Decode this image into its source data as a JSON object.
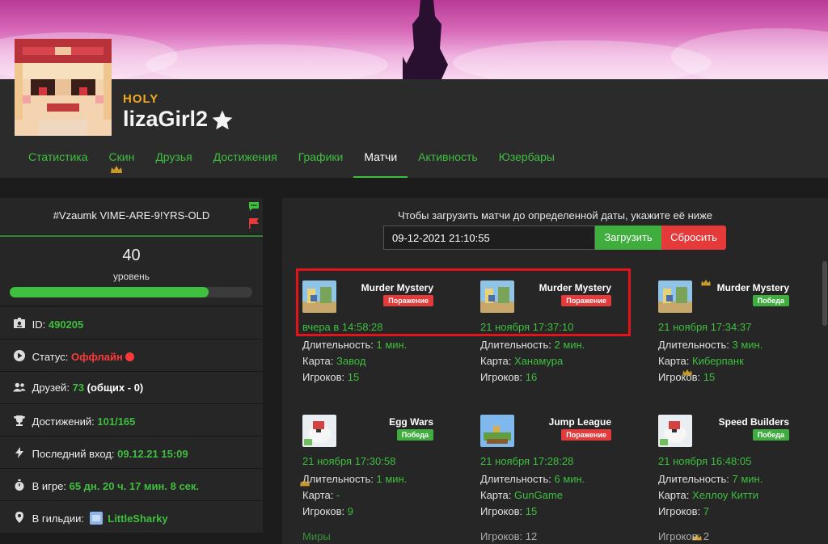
{
  "profile": {
    "rank": "HOLY",
    "nickname": "lizaGirl2"
  },
  "tabs": [
    {
      "label": "Статистика"
    },
    {
      "label": "Скин"
    },
    {
      "label": "Друзья"
    },
    {
      "label": "Достижения"
    },
    {
      "label": "Графики"
    },
    {
      "label": "Матчи"
    },
    {
      "label": "Активность"
    },
    {
      "label": "Юзербары"
    }
  ],
  "active_tab": "Матчи",
  "left": {
    "tag": "#Vzaumk VIME-ARE-9!YRS-OLD",
    "level": "40",
    "level_label": "уровень",
    "level_progress": 0.82,
    "id_label": "ID:",
    "id_value": "490205",
    "status_label": "Статус:",
    "status_value": "Оффлайн",
    "friends_label": "Друзей:",
    "friends_value": "73",
    "friends_common": "(общих - 0)",
    "achievements_label": "Достижений:",
    "achievements_value": "101/165",
    "last_login_label": "Последний вход:",
    "last_login_value": "09.12.21 15:09",
    "ingame_label": "В игре:",
    "ingame_value": "65 дн. 20 ч. 17 мин. 8 сек.",
    "guild_label": "В гильдии:",
    "guild_value": "LittleSharky"
  },
  "matches": {
    "hint": "Чтобы загрузить матчи до определенной даты, укажите её ниже",
    "date_value": "09-12-2021 21:10:55",
    "load_label": "Загрузить",
    "reset_label": "Сбросить",
    "duration_label": "Длительность:",
    "map_label": "Карта:",
    "players_label": "Игроков:",
    "cards": [
      {
        "game": "Murder Mystery",
        "result": "Поражение",
        "time": "вчера в 14:58:28",
        "duration": "1 мин.",
        "map": "Завод",
        "players": "15"
      },
      {
        "game": "Murder Mystery",
        "result": "Поражение",
        "time": "21 ноября 17:37:10",
        "duration": "2 мин.",
        "map": "Ханамура",
        "players": "16"
      },
      {
        "game": "Murder Mystery",
        "result": "Победа",
        "time": "21 ноября 17:34:37",
        "duration": "3 мин.",
        "map": "Киберпанк",
        "players": "15"
      },
      {
        "game": "Egg Wars",
        "result": "Победа",
        "time": "21 ноября 17:30:58",
        "duration": "1 мин.",
        "map": "-",
        "players": "9"
      },
      {
        "game": "Jump League",
        "result": "Поражение",
        "time": "21 ноября 17:28:28",
        "duration": "6 мин.",
        "map": "GunGame",
        "players": "15"
      },
      {
        "game": "Speed Builders",
        "result": "Победа",
        "time": "21 ноября 16:48:05",
        "duration": "7 мин.",
        "map": "Хеллоу Китти",
        "players": "7"
      }
    ],
    "partial_row": [
      "Миры",
      "Игроков: 12",
      "Игроков: 2"
    ]
  },
  "colors": {
    "accent": "#3ebf3e",
    "lose": "#e43a3a",
    "win": "#3fae3f",
    "rank": "#f2a81e",
    "highlight": "#e0141a"
  }
}
